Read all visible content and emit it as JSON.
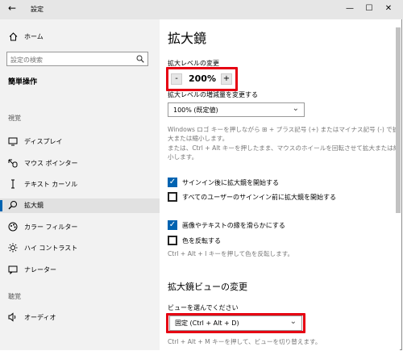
{
  "window": {
    "title": "設定",
    "back_glyph": "←",
    "minimize_glyph": "—",
    "maximize_glyph": "☐",
    "close_glyph": "✕"
  },
  "sidebar": {
    "home_label": "ホーム",
    "search_placeholder": "設定の検索",
    "category_title": "簡単操作",
    "section_vision": "視覚",
    "section_hearing": "聴覚",
    "items": [
      {
        "label": "ディスプレイ",
        "icon": "display-icon"
      },
      {
        "label": "マウス ポインター",
        "icon": "mouse-pointer-icon"
      },
      {
        "label": "テキスト カーソル",
        "icon": "text-cursor-icon"
      },
      {
        "label": "拡大鏡",
        "icon": "magnifier-icon",
        "selected": true
      },
      {
        "label": "カラー フィルター",
        "icon": "color-filter-icon"
      },
      {
        "label": "ハイ コントラスト",
        "icon": "high-contrast-icon"
      },
      {
        "label": "ナレーター",
        "icon": "narrator-icon"
      },
      {
        "label": "オーディオ",
        "icon": "audio-icon"
      }
    ]
  },
  "main": {
    "title": "拡大鏡",
    "zoom_label": "拡大レベルの変更",
    "zoom_minus": "-",
    "zoom_value": "200%",
    "zoom_plus": "+",
    "increment_label": "拡大レベルの増減量を変更する",
    "increment_value": "100% (既定値)",
    "desc1_line1": "Windows ロゴ キーを押しながら ⊞ + プラス記号 (+) またはマイナス記号 (-) で拡",
    "desc1_line2": "大または縮小します。",
    "desc2_line1": "または、Ctrl + Alt キーを押したまま、マウスのホイールを回転させて拡大または縮",
    "desc2_line2": "小します。",
    "checkbox1_label": "サインイン後に拡大鏡を開始する",
    "checkbox1_checked": true,
    "checkbox2_label": "すべてのユーザーのサインイン前に拡大鏡を開始する",
    "checkbox2_checked": false,
    "checkbox3_label": "画像やテキストの縁を滑らかにする",
    "checkbox3_checked": true,
    "checkbox4_label": "色を反転する",
    "checkbox4_checked": false,
    "invert_hint": "Ctrl + Alt + I キーを押して色を反転します。",
    "view_heading": "拡大鏡ビューの変更",
    "view_label": "ビューを選んでください",
    "view_value": "固定 (Ctrl + Alt + D)",
    "view_hint": "Ctrl + Alt + M キーを押して、ビューを切り替えます。",
    "check_glyph": "✓",
    "chevron_glyph": "⌄"
  },
  "colors": {
    "accent": "#0063b1",
    "highlight_box": "#e60012",
    "sidebar_bg": "#f2f2f2",
    "titlebar_bg": "#e6e6e6"
  }
}
